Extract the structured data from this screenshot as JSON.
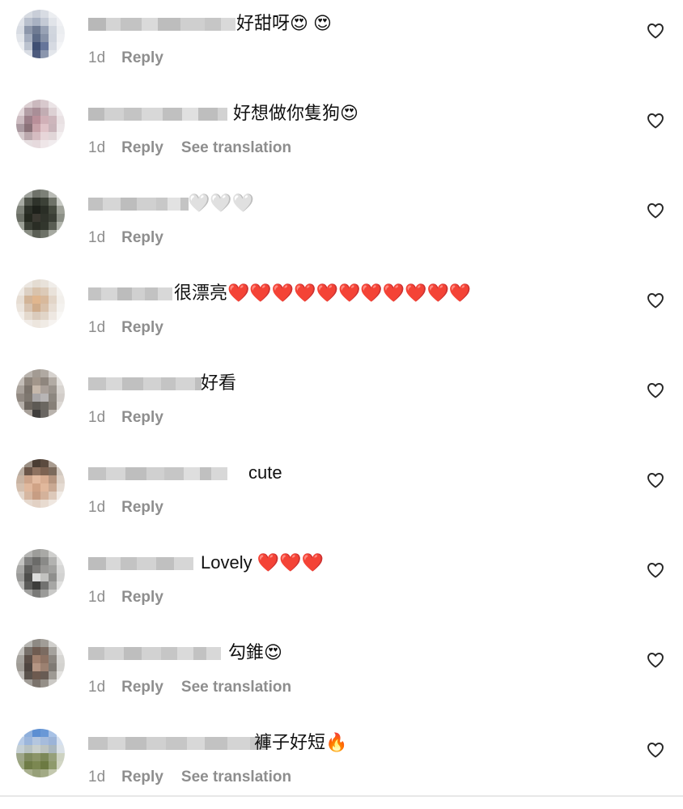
{
  "comments": [
    {
      "text": "好甜呀😍 😍",
      "time": "1d",
      "reply": "Reply",
      "translation": ""
    },
    {
      "text": "好想做你隻狗😍",
      "time": "1d",
      "reply": "Reply",
      "translation": "See translation"
    },
    {
      "text": "🤍🤍🤍",
      "time": "1d",
      "reply": "Reply",
      "translation": ""
    },
    {
      "text": "很漂亮❤️❤️❤️❤️❤️❤️❤️❤️❤️❤️❤️",
      "time": "1d",
      "reply": "Reply",
      "translation": ""
    },
    {
      "text": "好看",
      "time": "1d",
      "reply": "Reply",
      "translation": ""
    },
    {
      "text": "cute",
      "time": "1d",
      "reply": "Reply",
      "translation": ""
    },
    {
      "text": "Lovely ❤️❤️❤️",
      "time": "1d",
      "reply": "Reply",
      "translation": ""
    },
    {
      "text": "勾錐😍",
      "time": "1d",
      "reply": "Reply",
      "translation": "See translation"
    },
    {
      "text": "褲子好短🔥",
      "time": "1d",
      "reply": "Reply",
      "translation": "See translation"
    }
  ],
  "icons": {
    "like": "heart-outline-icon"
  },
  "colors": {
    "text": "#111111",
    "meta": "#8e8e8e",
    "background": "#ffffff"
  }
}
